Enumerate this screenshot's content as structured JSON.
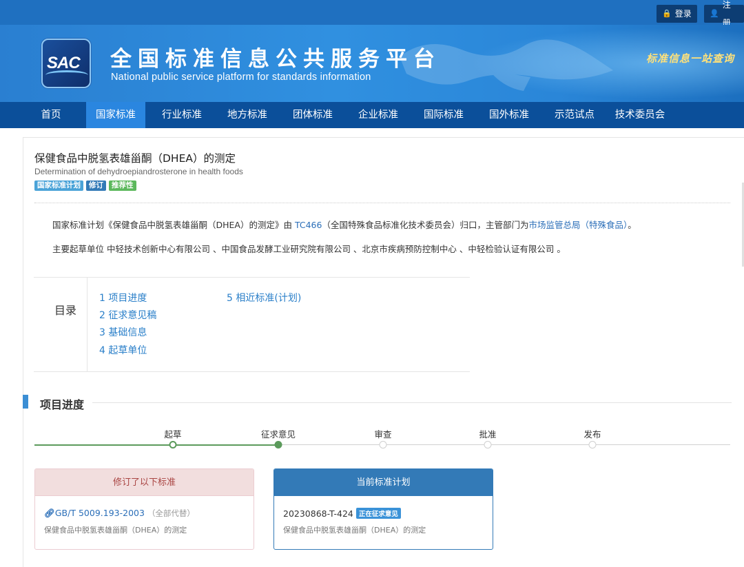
{
  "header": {
    "login_label": "登录",
    "register_label": "注册",
    "site_title": "全国标准信息公共服务平台",
    "site_subtitle": "National public service platform  for standards information",
    "logo_text": "SAC",
    "slogan": "标准信息一站查询"
  },
  "nav": {
    "items": [
      {
        "label": "首页"
      },
      {
        "label": "国家标准"
      },
      {
        "label": "行业标准"
      },
      {
        "label": "地方标准"
      },
      {
        "label": "团体标准"
      },
      {
        "label": "企业标准"
      },
      {
        "label": "国际标准"
      },
      {
        "label": "国外标准"
      },
      {
        "label": "示范试点"
      },
      {
        "label": "技术委员会"
      }
    ],
    "active": "国家标准"
  },
  "doc": {
    "title": "保健食品中脱氢表雄甾酮（DHEA）的测定",
    "title_en": "Determination of dehydroepiandrosterone in health foods",
    "badges": [
      "国家标准计划",
      "修订",
      "推荐性"
    ],
    "intro_prefix": "国家标准计划《保健食品中脱氢表雄甾酮（DHEA）的测定》由 ",
    "intro_tc_link": "TC466",
    "intro_middle": "（全国特殊食品标准化技术委员会）归口，主管部门为",
    "intro_dept_link": "市场监管总局（特殊食品）",
    "intro_suffix": "。",
    "drafters": "主要起草单位 中轻技术创新中心有限公司 、中国食品发酵工业研究院有限公司 、北京市疾病预防控制中心 、中轻检验认证有限公司 。"
  },
  "toc": {
    "label": "目录",
    "items": [
      "1 项目进度",
      "2 征求意见稿",
      "3 基础信息",
      "4 起草单位",
      "5 相近标准(计划)"
    ]
  },
  "progress": {
    "section_title": "项目进度",
    "stages": [
      "起草",
      "征求意见",
      "审查",
      "批准",
      "发布"
    ],
    "current_stage": "征求意见"
  },
  "cards": {
    "replaced": {
      "header": "修订了以下标准",
      "code": "GB/T 5009.193-2003",
      "note": "（全部代替）",
      "name": "保健食品中脱氢表雄甾酮（DHEA）的测定"
    },
    "current": {
      "header": "当前标准计划",
      "code": "20230868-T-424",
      "status": "正在征求意见",
      "name": "保健食品中脱氢表雄甾酮（DHEA）的测定"
    }
  },
  "colors": {
    "nav_bg": "#0b4f9a",
    "nav_active": "#2a86e0",
    "progress_green": "#5b9a5b",
    "link_blue": "#2a6eb8"
  }
}
